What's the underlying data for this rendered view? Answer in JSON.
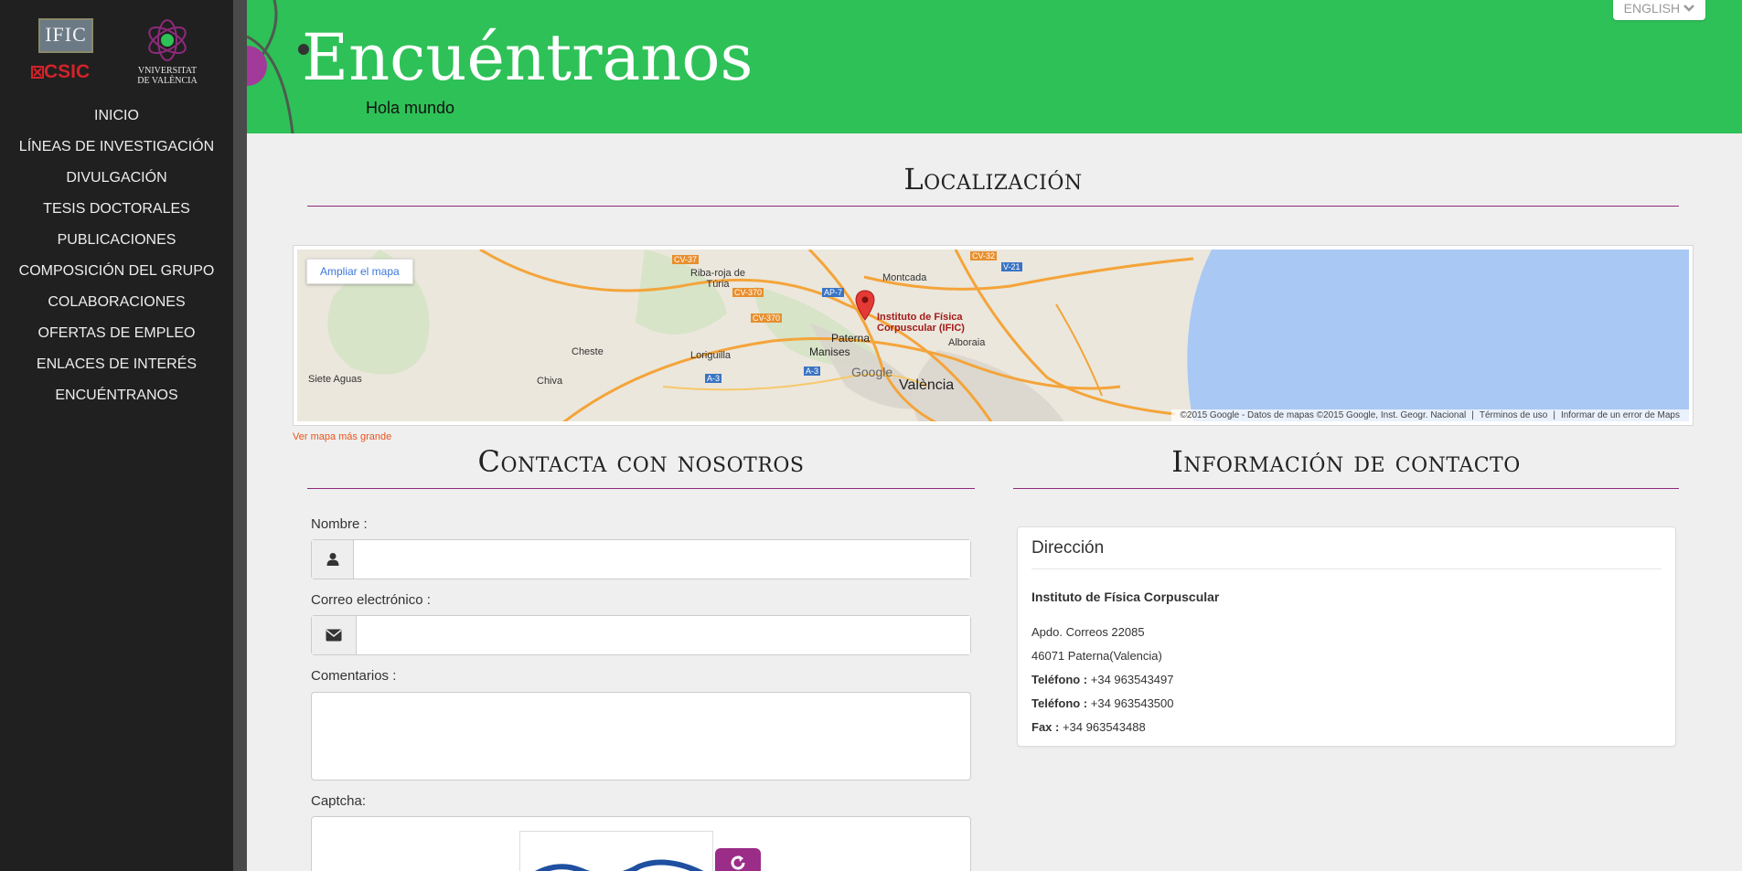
{
  "header": {
    "title": "Encuéntranos",
    "subtitle": "Hola mundo",
    "language_label": "ENGLISH"
  },
  "logos": {
    "ific": "IFIC",
    "csic": "CSIC",
    "uv": "VNIVERSITAT DE VALÈNCIA"
  },
  "sidebar": {
    "items": [
      {
        "label": "INICIO"
      },
      {
        "label": "LÍNEAS DE INVESTIGACIÓN"
      },
      {
        "label": "DIVULGACIÓN"
      },
      {
        "label": "TESIS DOCTORALES"
      },
      {
        "label": "PUBLICACIONES"
      },
      {
        "label": "COMPOSICIÓN DEL GRUPO"
      },
      {
        "label": "COLABORACIONES"
      },
      {
        "label": "OFERTAS DE EMPLEO"
      },
      {
        "label": "ENLACES DE INTERÉS"
      },
      {
        "label": "ENCUÉNTRANOS"
      }
    ]
  },
  "location": {
    "title": "Localización",
    "enlarge_map": "Ampliar el mapa",
    "larger_map_link": "Ver mapa más grande",
    "marker_label_line1": "Instituto de Física",
    "marker_label_line2": "Corpuscular (IFIC)",
    "places": [
      "Riba-roja de Túria",
      "Montcada",
      "Paterna",
      "Manises",
      "Alboraia",
      "Cheste",
      "Loriguilla",
      "Siete Aguas",
      "Chiva",
      "València",
      "Google"
    ],
    "road_labels": [
      "CV-37",
      "CV-370",
      "CV-370",
      "AP-7",
      "CV-32",
      "V-21",
      "A-3",
      "A-3"
    ],
    "attribution": "©2015 Google - Datos de mapas ©2015 Google, Inst. Geogr. Nacional",
    "terms": "Términos de uso",
    "report": "Informar de un error de Maps"
  },
  "contact_form": {
    "title": "Contacta con nosotros",
    "name_label": "Nombre :",
    "email_label": "Correo electrónico :",
    "comments_label": "Comentarios :",
    "captcha_label": "Captcha:",
    "name_value": "",
    "email_value": "",
    "comments_value": ""
  },
  "contact_info": {
    "title": "Información de contacto",
    "panel_title": "Dirección",
    "organization": "Instituto de Física Corpuscular",
    "address1": "Apdo. Correos 22085",
    "address2": "46071 Paterna(Valencia)",
    "phone_label": "Teléfono :",
    "phone1": "+34 963543497",
    "phone2": "+34 963543500",
    "fax_label": "Fax :",
    "fax": "+34 963543488"
  },
  "colors": {
    "header_green": "#2ec157",
    "accent_purple": "#8e2a7c",
    "sidebar_bg": "#202020"
  },
  "icons": [
    "user-icon",
    "envelope-icon",
    "refresh-icon",
    "map-marker-icon",
    "chevron-down-icon"
  ]
}
